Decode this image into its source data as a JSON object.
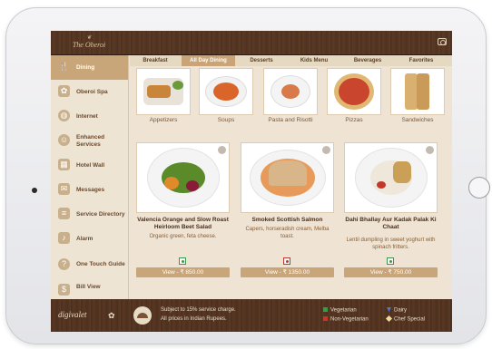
{
  "app": {
    "logo_text": "The Oberoi"
  },
  "sidebar": {
    "items": [
      {
        "label": "Dining",
        "icon": "fork-knife-icon"
      },
      {
        "label": "Oberoi Spa",
        "icon": "spa-icon"
      },
      {
        "label": "Internet",
        "icon": "globe-icon"
      },
      {
        "label": "Enhanced Services",
        "icon": "services-icon"
      },
      {
        "label": "Hotel Wall",
        "icon": "wall-icon"
      },
      {
        "label": "Messages",
        "icon": "message-icon"
      },
      {
        "label": "Service Directory",
        "icon": "directory-icon"
      },
      {
        "label": "Alarm",
        "icon": "bell-icon"
      },
      {
        "label": "One Touch Guide",
        "icon": "guide-icon"
      },
      {
        "label": "Bill View",
        "icon": "bill-icon"
      }
    ],
    "active_index": 0
  },
  "tabs": [
    "Breakfast",
    "All Day Dining",
    "Desserts",
    "Kids Menu",
    "Beverages",
    "Favorites"
  ],
  "active_tab": "All Day Dining",
  "categories": [
    {
      "label": "Appetizers"
    },
    {
      "label": "Soups"
    },
    {
      "label": "Pasta and Risotti"
    },
    {
      "label": "Pizzas"
    },
    {
      "label": "Sandwiches"
    }
  ],
  "cards": [
    {
      "title": "Valencia Orange and Slow Roast Heirloom Beet Salad",
      "desc": "Organic green, feta cheese.",
      "diet": "veg",
      "view_label": "View - ₹ 850.00"
    },
    {
      "title": "Smoked Scottish Salmon",
      "desc": "Capers, horseradish cream, Melba toast.",
      "diet": "non-veg",
      "view_label": "View - ₹ 1350.00"
    },
    {
      "title": "Dahi Bhallay Aur Kadak Palak Ki Chaat",
      "desc": "Lentil dumpling in sweet yoghurt with spinach fritters.",
      "diet": "veg",
      "view_label": "View - ₹ 750.00"
    }
  ],
  "footer": {
    "brand": "digivalet",
    "note_line1": "Subject to 15% service charge.",
    "note_line2": "All prices in Indian Rupees.",
    "legend": {
      "veg": "Vegetarian",
      "nonveg": "Non-Vegetarian",
      "dairy": "Dairy",
      "chef": "Chef Special"
    }
  },
  "colors": {
    "wood": "#4b2f1e",
    "accent": "#c9a57a",
    "veg": "#3a9a4a",
    "nonveg": "#c0392b"
  }
}
